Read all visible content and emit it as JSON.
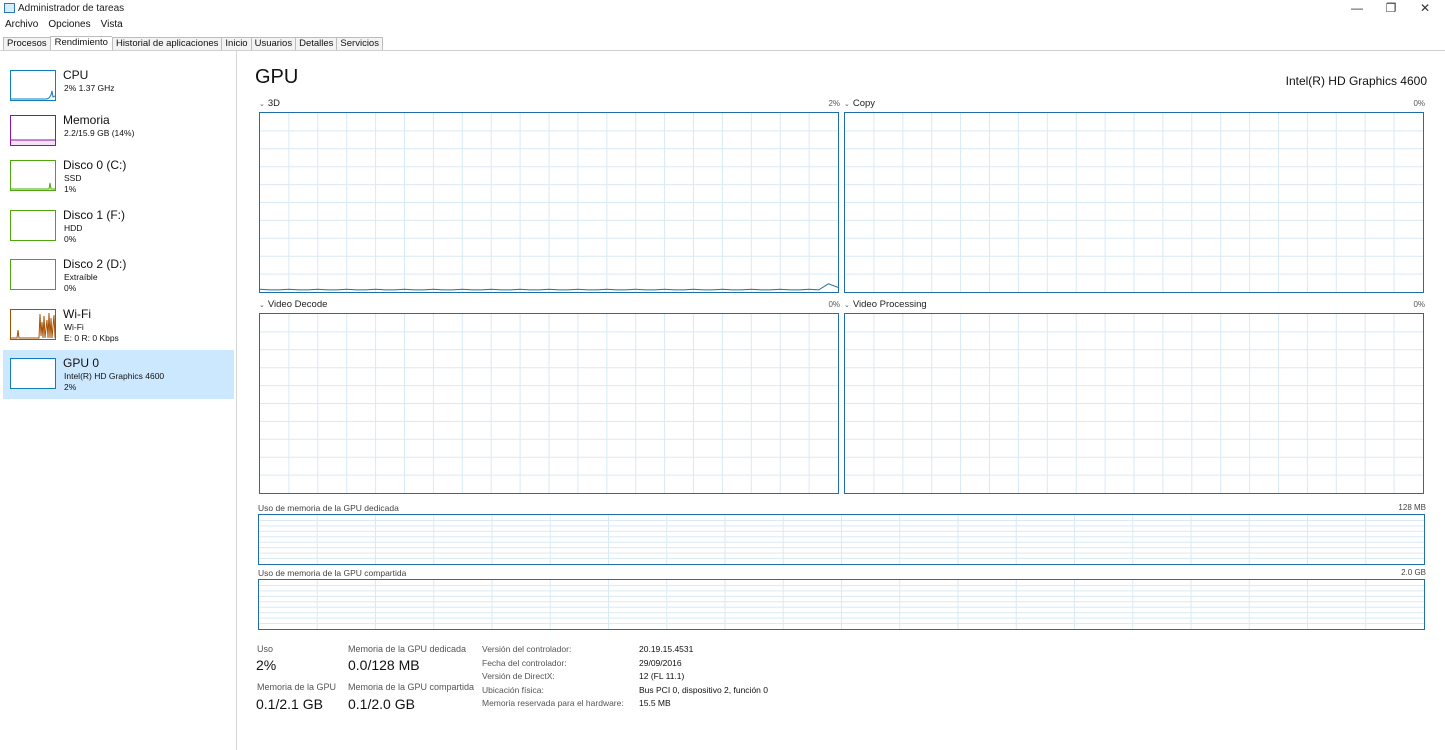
{
  "window": {
    "title": "Administrador de tareas",
    "minimize_glyph": "—",
    "maximize_glyph": "❐",
    "close_glyph": "✕"
  },
  "menu": [
    "Archivo",
    "Opciones",
    "Vista"
  ],
  "tabs": [
    "Procesos",
    "Rendimiento",
    "Historial de aplicaciones",
    "Inicio",
    "Usuarios",
    "Detalles",
    "Servicios"
  ],
  "sidebar": {
    "items": [
      {
        "title": "CPU",
        "sub1": "2% 1.37 GHz",
        "sub2": "",
        "color": "#117dbb"
      },
      {
        "title": "Memoria",
        "sub1": "2.2/15.9 GB (14%)",
        "sub2": "",
        "color": "#8b12ae"
      },
      {
        "title": "Disco 0 (C:)",
        "sub1": "SSD",
        "sub2": "1%",
        "color": "#4da60c"
      },
      {
        "title": "Disco 1 (F:)",
        "sub1": "HDD",
        "sub2": "0%",
        "color": "#4da60c"
      },
      {
        "title": "Disco 2 (D:)",
        "sub1": "Extraíble",
        "sub2": "0%",
        "color": "#4da60c"
      },
      {
        "title": "Wi-Fi",
        "sub1": "Wi-Fi",
        "sub2": "E: 0 R: 0 Kbps",
        "color": "#a74f01"
      },
      {
        "title": "GPU 0",
        "sub1": "Intel(R) HD Graphics 4600",
        "sub2": "2%",
        "color": "#117dbb"
      }
    ]
  },
  "main": {
    "title": "GPU",
    "device": "Intel(R) HD Graphics 4600",
    "accent": "#1e6fa9",
    "engines": [
      {
        "label": "3D",
        "pct": "2%"
      },
      {
        "label": "Copy",
        "pct": "0%"
      },
      {
        "label": "Video Decode",
        "pct": "0%"
      },
      {
        "label": "Video Processing",
        "pct": "0%"
      }
    ],
    "dedicated_mem": {
      "label": "Uso de memoria de la GPU dedicada",
      "max": "128 MB"
    },
    "shared_mem": {
      "label": "Uso de memoria de la GPU compartida",
      "max": "2.0 GB"
    }
  },
  "stats": {
    "uso_label": "Uso",
    "uso_value": "2%",
    "dedicada_label": "Memoria de la GPU dedicada",
    "dedicada_value": "0.0/128 MB",
    "gpu_mem_label": "Memoria de la GPU",
    "gpu_mem_value": "0.1/2.1 GB",
    "compartida_label": "Memoria de la GPU compartida",
    "compartida_value": "0.1/2.0 GB"
  },
  "info": [
    {
      "label": "Versión del controlador:",
      "value": "20.19.15.4531"
    },
    {
      "label": "Fecha del controlador:",
      "value": "29/09/2016"
    },
    {
      "label": "Versión de DirectX:",
      "value": "12 (FL 11.1)"
    },
    {
      "label": "Ubicación física:",
      "value": "Bus PCI 0, dispositivo 2, función 0"
    },
    {
      "label": "Memoria reservada para el hardware:",
      "value": "15.5 MB"
    }
  ]
}
